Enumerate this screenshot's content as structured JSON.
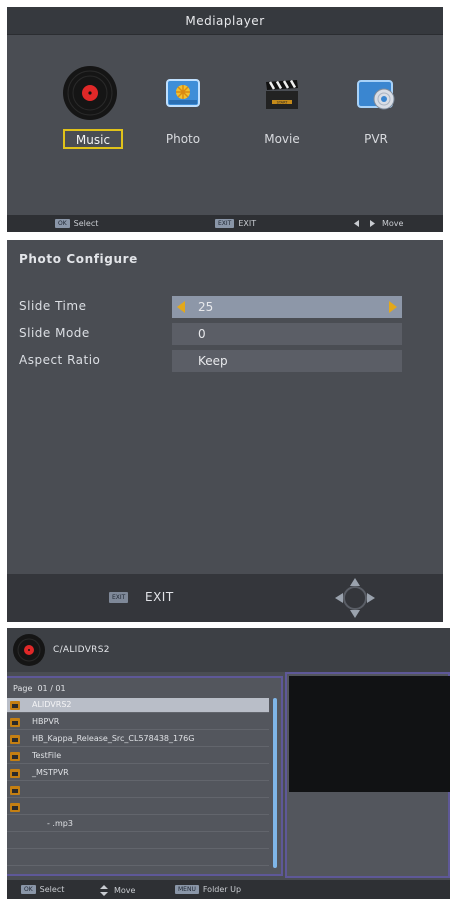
{
  "mediaplayer": {
    "title": "Mediaplayer",
    "items": [
      {
        "label": "Music",
        "icon": "vinyl-record-icon",
        "selected": true
      },
      {
        "label": "Photo",
        "icon": "photo-icon",
        "selected": false
      },
      {
        "label": "Movie",
        "icon": "clapperboard-icon",
        "selected": false
      },
      {
        "label": "PVR",
        "icon": "pvr-disc-icon",
        "selected": false
      }
    ],
    "footer": {
      "ok_key": "OK",
      "select_label": "Select",
      "exit_key": "EXIT",
      "exit_label": "EXIT",
      "move_label": "Move"
    }
  },
  "photo_configure": {
    "title": "Photo Configure",
    "rows": [
      {
        "key": "Slide Time",
        "value": "25",
        "selected": true
      },
      {
        "key": "Slide Mode",
        "value": "0",
        "selected": false
      },
      {
        "key": "Aspect Ratio",
        "value": "Keep",
        "selected": false
      }
    ],
    "footer": {
      "exit_key": "EXIT",
      "exit_label": "EXIT"
    }
  },
  "browser": {
    "path": "C/ALIDVRS2",
    "page_label": "Page",
    "page_value": "01 / 01",
    "entries": [
      {
        "name": "ALIDVRS2",
        "folder": true,
        "selected": true
      },
      {
        "name": "HBPVR",
        "folder": true,
        "selected": false
      },
      {
        "name": "HB_Kappa_Release_Src_CL578438_176G",
        "folder": true,
        "selected": false
      },
      {
        "name": "TestFile",
        "folder": true,
        "selected": false
      },
      {
        "name": "_MSTPVR",
        "folder": true,
        "selected": false
      },
      {
        "name": "",
        "folder": true,
        "selected": false
      },
      {
        "name": "",
        "folder": true,
        "selected": false
      },
      {
        "name": "-        .mp3",
        "folder": false,
        "selected": false
      },
      {
        "name": "",
        "folder": false,
        "selected": false
      },
      {
        "name": "",
        "folder": false,
        "selected": false
      }
    ],
    "footer": {
      "ok_key": "OK",
      "select_label": "Select",
      "move_label": "Move",
      "menu_key": "MENU",
      "folder_up_label": "Folder Up"
    }
  },
  "colors": {
    "panel": "#4a4d53",
    "highlight": "#e0c21a",
    "arrow": "#e3a81a",
    "selected_row": "#8d97a8"
  }
}
